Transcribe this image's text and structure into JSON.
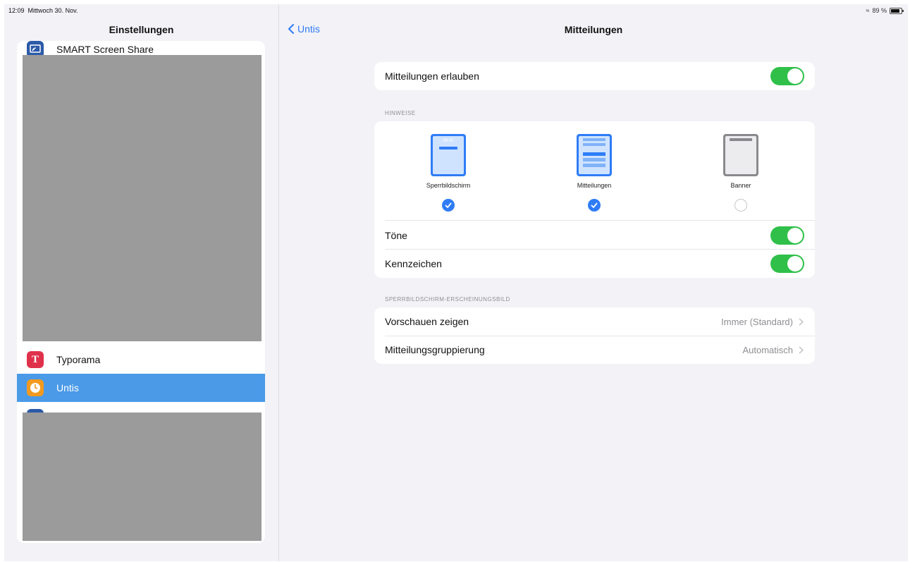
{
  "status": {
    "time": "12:09",
    "date": "Mittwoch 30. Nov.",
    "battery": "89 %"
  },
  "sidebar": {
    "title": "Einstellungen",
    "items": [
      {
        "label": "SMART Screen Share",
        "icon": "screen-share-icon",
        "color": "#2b5aa8"
      },
      {
        "label": "Typorama",
        "icon": "typorama-icon",
        "color": "#e0314b"
      },
      {
        "label": "Untis",
        "icon": "untis-clock-icon",
        "color": "#f29a1f",
        "selected": true
      }
    ]
  },
  "nav": {
    "back_label": "Untis",
    "title": "Mitteilungen"
  },
  "allow": {
    "label": "Mitteilungen erlauben",
    "on": true
  },
  "hinweise": {
    "header": "HINWEISE",
    "options": [
      {
        "label": "Sperrbildschirm",
        "checked": true,
        "preview_time": "09:41"
      },
      {
        "label": "Mitteilungen",
        "checked": true
      },
      {
        "label": "Banner",
        "checked": false
      }
    ],
    "toggles": [
      {
        "label": "Töne",
        "on": true
      },
      {
        "label": "Kennzeichen",
        "on": true
      }
    ]
  },
  "lockscreen": {
    "header": "SPERRBILDSCHIRM-ERSCHEINUNGSBILD",
    "rows": [
      {
        "label": "Vorschauen zeigen",
        "value": "Immer (Standard)"
      },
      {
        "label": "Mitteilungsgruppierung",
        "value": "Automatisch"
      }
    ]
  },
  "colors": {
    "accent": "#2f7cf6",
    "toggle_on": "#30c04a",
    "selection": "#4a9ae8"
  }
}
